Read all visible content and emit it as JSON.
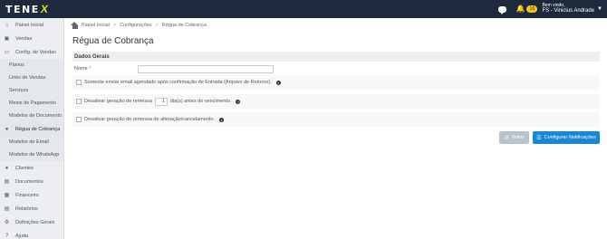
{
  "header": {
    "logo": "TENE",
    "logo_accent": "X",
    "notifications_count": "16",
    "user_greeting": "Bem vindo,",
    "user_name": "FS - Vinicius Andrade"
  },
  "sidebar": {
    "items": [
      {
        "label": "Painel Inicial",
        "icon": "home-icon"
      },
      {
        "label": "Vendas",
        "icon": "cart-icon"
      },
      {
        "label": "Config. de Vendas",
        "icon": "card-icon"
      },
      {
        "label": "Planos"
      },
      {
        "label": "Links de Vendas"
      },
      {
        "label": "Serviços"
      },
      {
        "label": "Meios de Pagamento"
      },
      {
        "label": "Modelos de Documento"
      },
      {
        "label": "Régua de Cobrança",
        "icon": "circle-icon"
      },
      {
        "label": "Modelos de Email"
      },
      {
        "label": "Modelos de WhatsApp"
      },
      {
        "label": "Clientes",
        "icon": "user-icon"
      },
      {
        "label": "Documentos",
        "icon": "doc-icon"
      },
      {
        "label": "Financeiro",
        "icon": "bank-icon"
      },
      {
        "label": "Relatórios",
        "icon": "chart-icon"
      },
      {
        "label": "Definições Gerais",
        "icon": "gears-icon"
      },
      {
        "label": "Ajuda",
        "icon": "help-icon"
      }
    ]
  },
  "breadcrumb": {
    "items": [
      "Painel Inicial",
      "Configurações",
      "Régua de Cobrança"
    ]
  },
  "page": {
    "title": "Régua de Cobrança",
    "section_title": "Dados Gerais",
    "name_label": "Nome",
    "name_required": "*",
    "name_value": "",
    "option1": "Somente enviar email agendado após confirmação de Entrada (Arquivo de Retorno).",
    "option2_prefix": "Desativar geração de remessa",
    "option2_days": "1",
    "option2_suffix": "dia(s) antes do vencimento.",
    "option3": "Desativar geração de remessa de alteração/cancelamento."
  },
  "buttons": {
    "back": "Voltar",
    "configure": "Configurar Notificações"
  },
  "colors": {
    "topbar": "#1e2a3c",
    "primary": "#1a86d6",
    "accent": "#d6e02a",
    "badge": "#f0c419"
  }
}
